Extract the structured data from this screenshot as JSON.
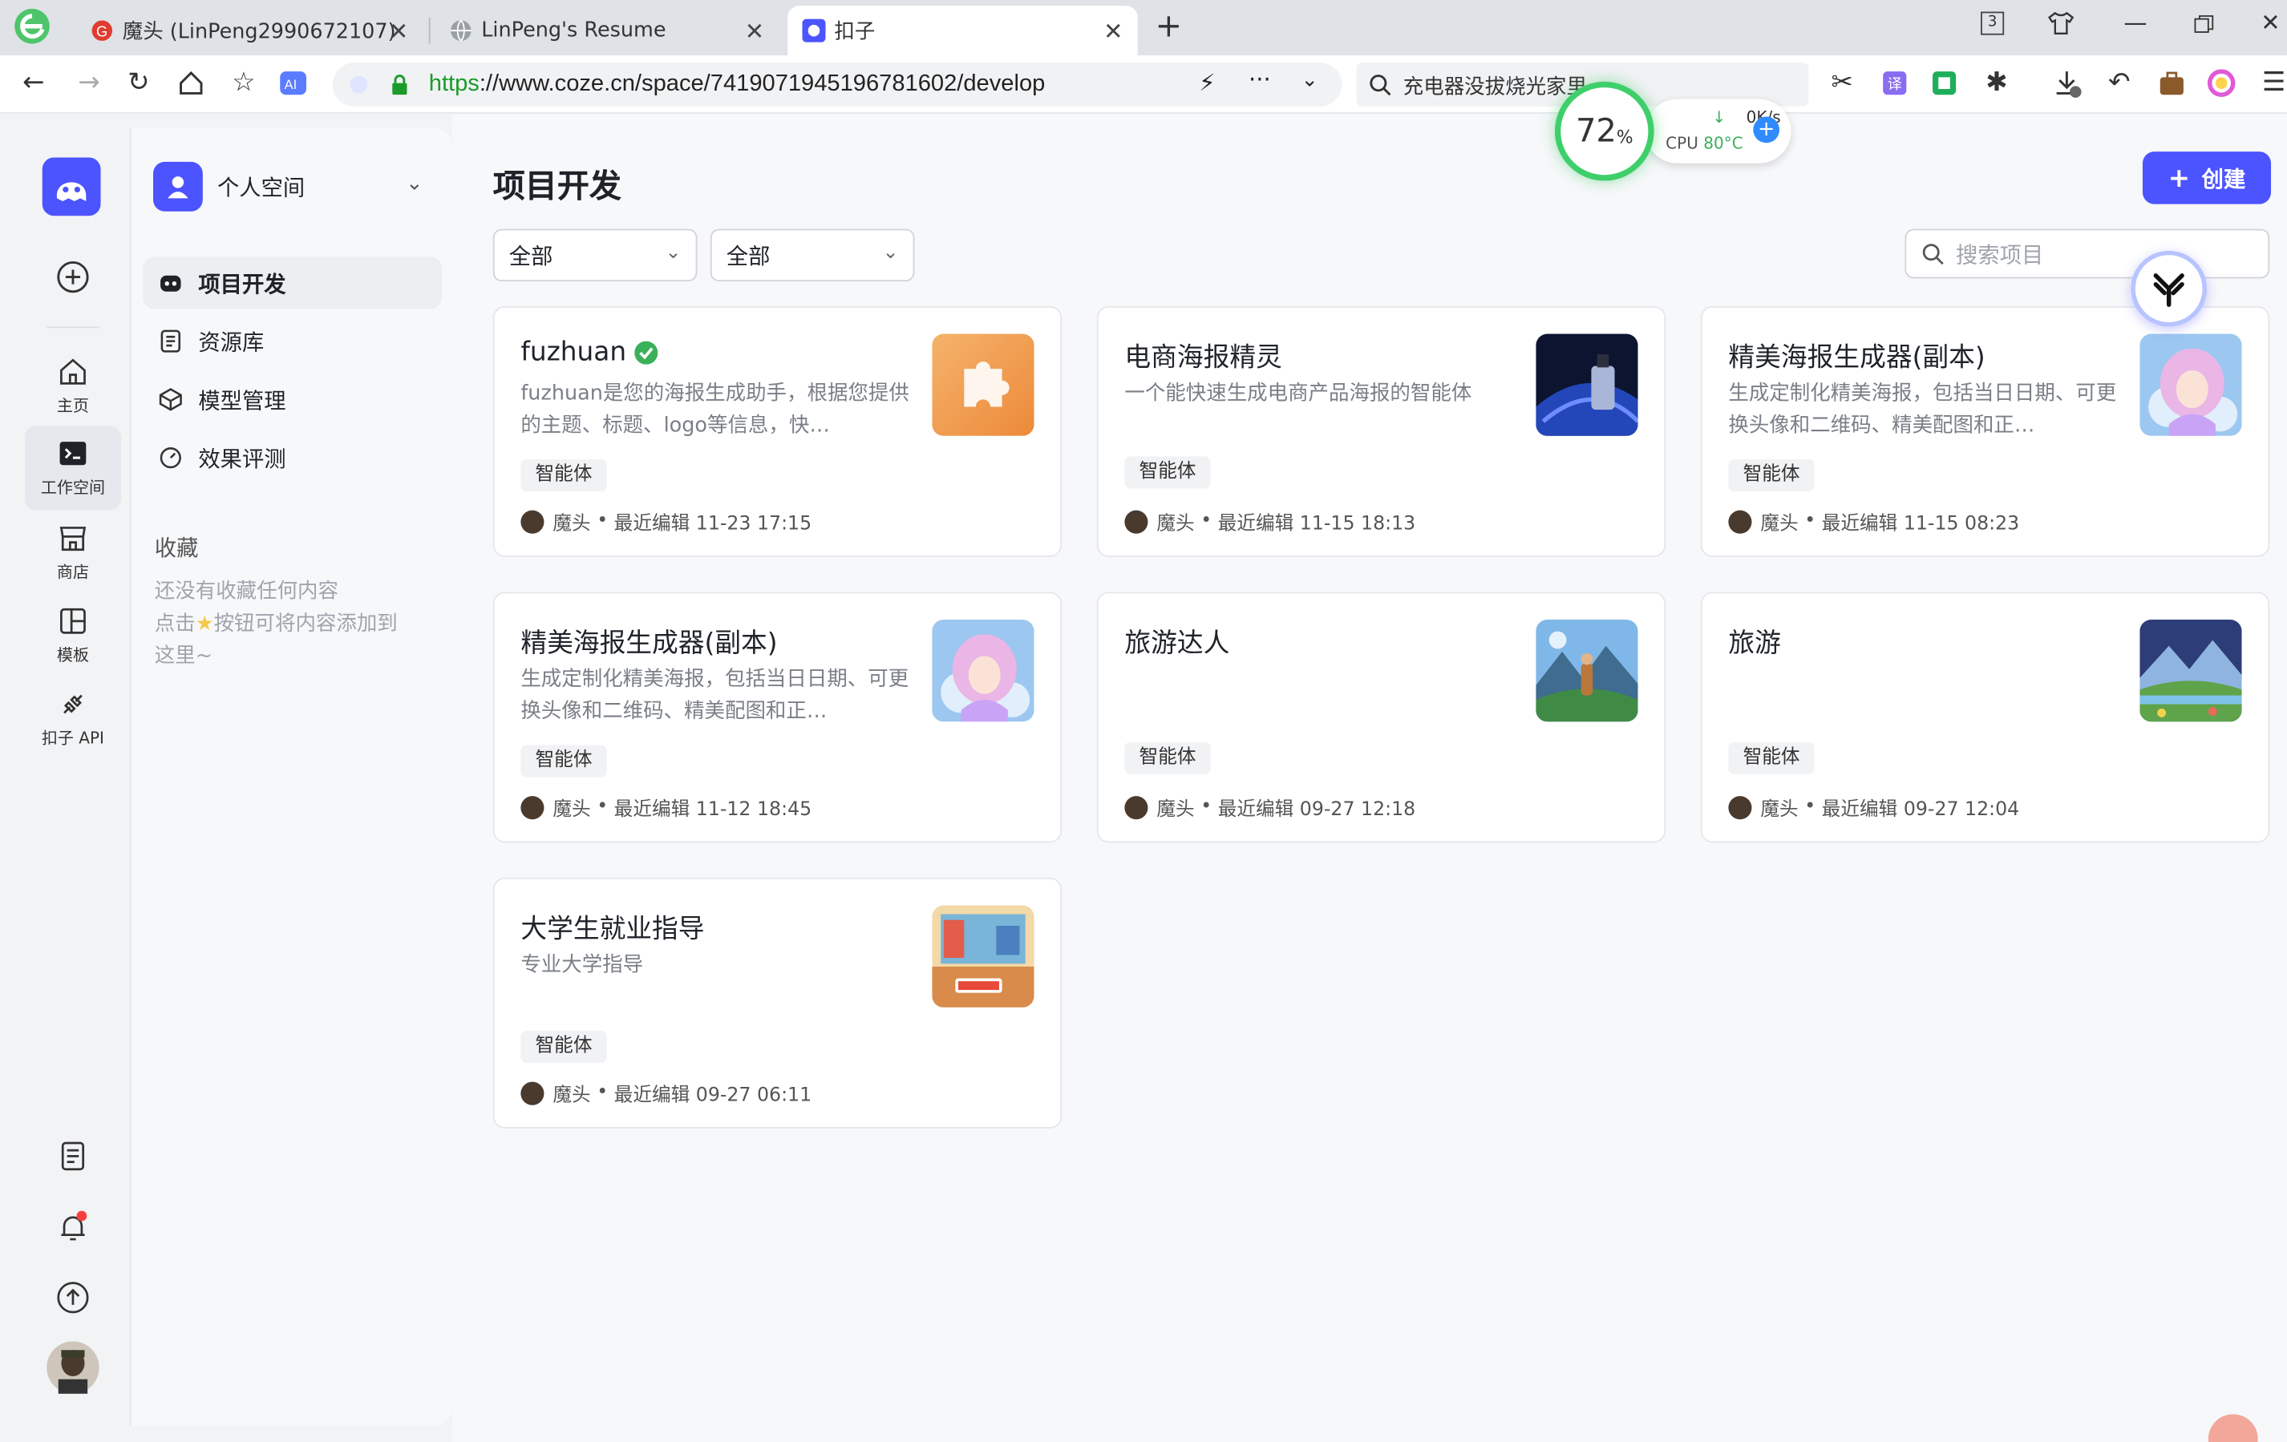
{
  "browser": {
    "tabs": [
      {
        "title": "魔头 (LinPeng2990672107)"
      },
      {
        "title": "LinPeng's Resume"
      },
      {
        "title": "扣子"
      }
    ],
    "url": {
      "scheme": "https",
      "rest": "://www.coze.cn/space/7419071945196781602/develop"
    },
    "search_value": "充电器没拔烧光家里",
    "tab_count": "3"
  },
  "perf_widget": {
    "cpu_load": "72",
    "cpu_load_unit": "%",
    "net_speed": "0K/s",
    "cpu_label": "CPU",
    "cpu_temp": "80°C"
  },
  "rail": {
    "items": [
      {
        "label": "主页"
      },
      {
        "label": "工作空间"
      },
      {
        "label": "商店"
      },
      {
        "label": "模板"
      },
      {
        "label": "扣子 API"
      }
    ]
  },
  "sidebar": {
    "space_name": "个人空间",
    "nav": [
      {
        "label": "项目开发"
      },
      {
        "label": "资源库"
      },
      {
        "label": "模型管理"
      },
      {
        "label": "效果评测"
      }
    ],
    "favorites_title": "收藏",
    "favorites_empty_line1": "还没有收藏任何内容",
    "favorites_empty_line2_pre": "点击",
    "favorites_empty_line2_post": "按钮可将内容添加到",
    "favorites_empty_line3": "这里~"
  },
  "main": {
    "title": "项目开发",
    "create_label": "创建",
    "filters": [
      "全部",
      "全部"
    ],
    "search_placeholder": "搜索项目",
    "cards": [
      {
        "title": "fuzhuan",
        "verified": true,
        "desc": "fuzhuan是您的海报生成助手，根据您提供的主题、标题、logo等信息，快…",
        "tag": "智能体",
        "author": "魔头",
        "meta": "最近编辑 11-23 17:15",
        "thumb": "puzzle"
      },
      {
        "title": "电商海报精灵",
        "desc": "一个能快速生成电商产品海报的智能体",
        "tag": "智能体",
        "author": "魔头",
        "meta": "最近编辑 11-15 18:13",
        "thumb": "perfume"
      },
      {
        "title": "精美海报生成器(副本)",
        "desc": "生成定制化精美海报，包括当日日期、可更换头像和二维码、精美配图和正…",
        "tag": "智能体",
        "author": "魔头",
        "meta": "最近编辑 11-15 08:23",
        "thumb": "anime-girl"
      },
      {
        "title": "精美海报生成器(副本)",
        "desc": "生成定制化精美海报，包括当日日期、可更换头像和二维码、精美配图和正…",
        "tag": "智能体",
        "author": "魔头",
        "meta": "最近编辑 11-12 18:45",
        "thumb": "anime-girl"
      },
      {
        "title": "旅游达人",
        "desc": "",
        "tag": "智能体",
        "author": "魔头",
        "meta": "最近编辑 09-27 12:18",
        "thumb": "mountain-hiker"
      },
      {
        "title": "旅游",
        "desc": "",
        "tag": "智能体",
        "author": "魔头",
        "meta": "最近编辑 09-27 12:04",
        "thumb": "mountain-lake"
      },
      {
        "title": "大学生就业指导",
        "desc": "专业大学指导",
        "tag": "智能体",
        "author": "魔头",
        "meta": "最近编辑 09-27 06:11",
        "thumb": "study-desk"
      }
    ]
  },
  "colors": {
    "brand": "#4c54ff",
    "verified": "#3ab05a",
    "notification_dot": "#f53f3f"
  }
}
